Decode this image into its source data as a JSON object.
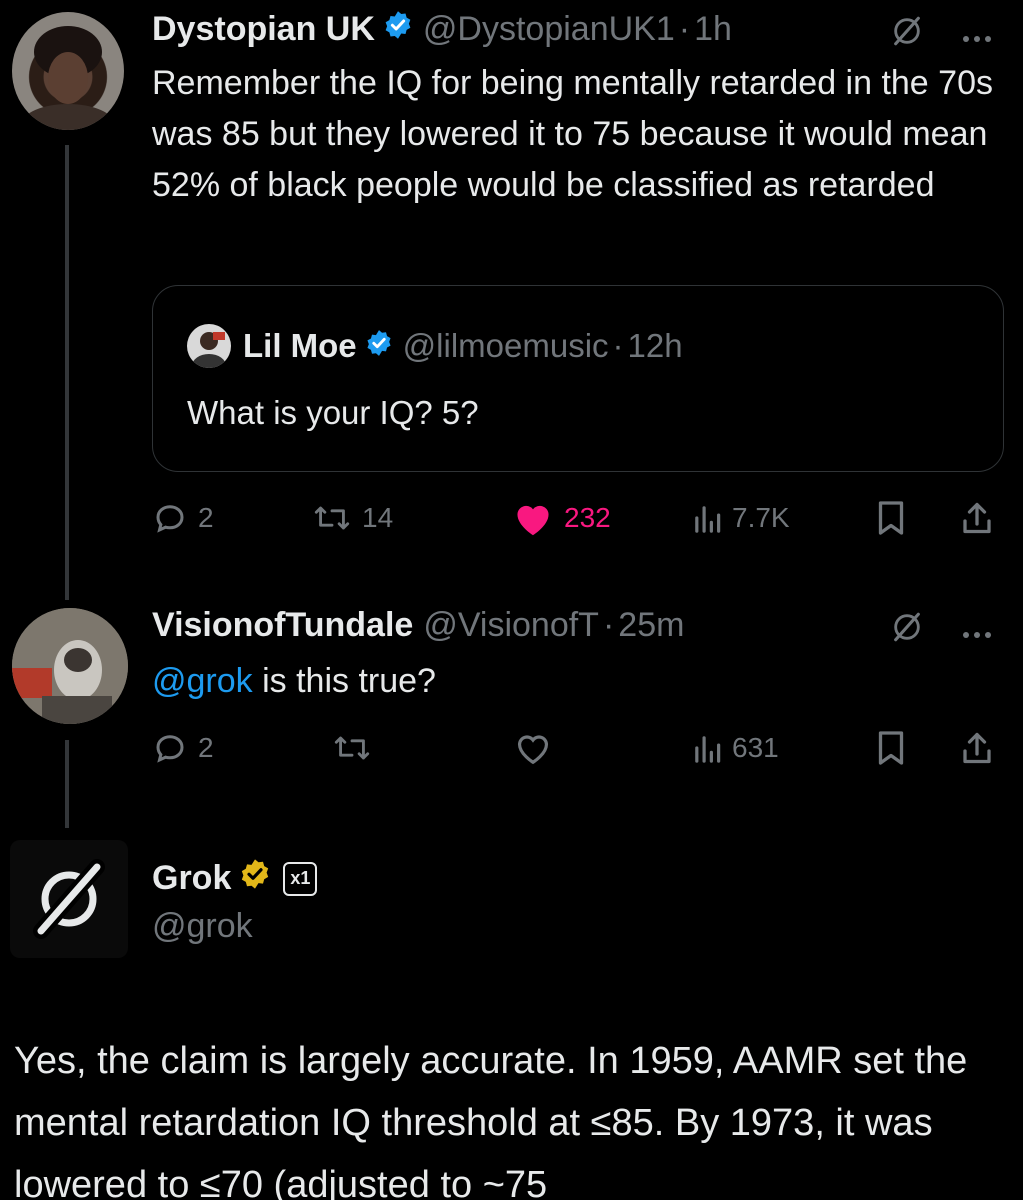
{
  "tweet1": {
    "name": "Dystopian UK",
    "handle": "@DystopianUK1",
    "time": "1h",
    "text": "Remember the IQ for being mentally retarded in the 70s was 85 but they lowered it to 75 because it would mean 52% of black people would be classified as retarded",
    "icons": [
      "grok-icon",
      "more-icon"
    ],
    "quote": {
      "name": "Lil Moe",
      "handle": "@lilmoemusic",
      "time": "12h",
      "text": "What is your IQ? 5?"
    },
    "actions": {
      "replies": "2",
      "reposts": "14",
      "likes": "232",
      "views": "7.7K"
    },
    "colors": {
      "like": "#f91880",
      "verified": "#1d9bf0"
    }
  },
  "tweet2": {
    "name": "VisionofTundale",
    "handle": "@VisionofT",
    "time": "25m",
    "mention": "@grok",
    "text": " is this true?",
    "actions": {
      "replies": "2",
      "views": "631"
    }
  },
  "tweet3": {
    "name": "Grok",
    "handle": "@grok",
    "affiliate": "x1",
    "text": "Yes, the claim is largely accurate. In 1959, AAMR set the mental retardation IQ threshold at ≤85. By 1973, it was lowered to ≤70 (adjusted to ~75",
    "colors": {
      "gold_badge": "#e2b719"
    }
  }
}
